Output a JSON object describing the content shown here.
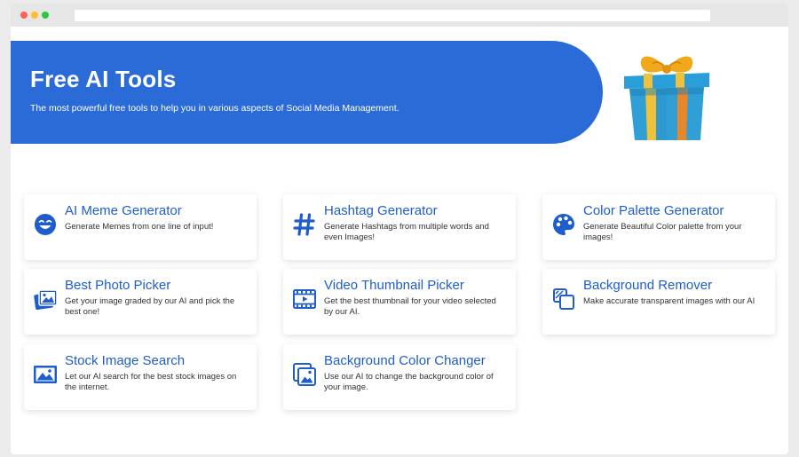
{
  "hero": {
    "title": "Free AI Tools",
    "subtitle": "The most powerful free tools to help you in various aspects of Social Media Management."
  },
  "colors": {
    "accent": "#2b6bd8",
    "title_blue": "#1f5dcc",
    "icon_blue": "#1f5dcc"
  },
  "tools": [
    {
      "title": "AI Meme Generator",
      "description": "Generate Memes from one line of input!",
      "icon": "smiley-icon"
    },
    {
      "title": "Hashtag Generator",
      "description": "Generate Hashtags from multiple words and even Images!",
      "icon": "hashtag-icon"
    },
    {
      "title": "Color Palette Generator",
      "description": "Generate Beautiful Color palette from your images!",
      "icon": "palette-icon"
    },
    {
      "title": "Best Photo Picker",
      "description": "Get your image graded by our AI and pick the best one!",
      "icon": "photos-icon"
    },
    {
      "title": "Video Thumbnail Picker",
      "description": "Get the best thumbnail for your video selected by our AI.",
      "icon": "film-icon"
    },
    {
      "title": "Background Remover",
      "description": "Make accurate transparent images with our AI",
      "icon": "layers-icon"
    },
    {
      "title": "Stock Image Search",
      "description": "Let our AI search for the best stock images on the internet.",
      "icon": "image-icon"
    },
    {
      "title": "Background Color Changer",
      "description": "Use our AI to change the background color of your image.",
      "icon": "image-stack-icon"
    }
  ]
}
